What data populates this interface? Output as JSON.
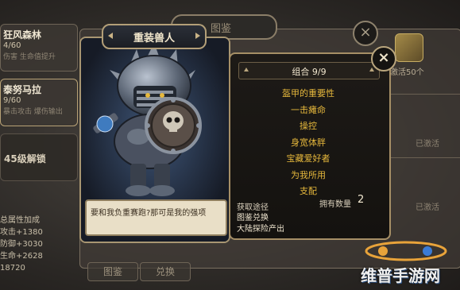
{
  "left_list": {
    "cards": [
      {
        "name": "狂风森林",
        "progress": "4/60",
        "desc": "伤害 生命值提升"
      },
      {
        "name": "泰努马拉",
        "progress": "9/60",
        "desc": "暴击攻击 爆伤输出"
      }
    ],
    "locked_label": "45级解锁",
    "stats_title": "总属性加成",
    "stats": [
      "攻击+1380",
      "防御+3030",
      "生命+2628",
      "18720"
    ]
  },
  "back_panel": {
    "tab_label": "图鉴",
    "close_glyph": "×",
    "bottom_buttons": [
      "图鉴",
      "兑换"
    ]
  },
  "right_col": {
    "badge_label": "激活50个",
    "activated_label": "已激活"
  },
  "card": {
    "title": "重装兽人",
    "quote": "要和我负重赛跑?那可是我的强项"
  },
  "info": {
    "combo_label": "组合 9/9",
    "traits": [
      "盔甲的重要性",
      "一击瘫命",
      "操控",
      "身宽体胖",
      "宝藏爱好者",
      "为我所用",
      "支配"
    ],
    "acquire_label": "获取途径",
    "own_label": "拥有数量",
    "own_count": "2",
    "acquire_methods": [
      "图鉴兑换",
      "大陆探险产出"
    ]
  },
  "close_glyph": "×",
  "watermark": {
    "text": "维普手游网"
  },
  "colors": {
    "accent_gold": "#e6b83c",
    "frame": "#a89672",
    "panel_dark": "#1d1a17"
  }
}
